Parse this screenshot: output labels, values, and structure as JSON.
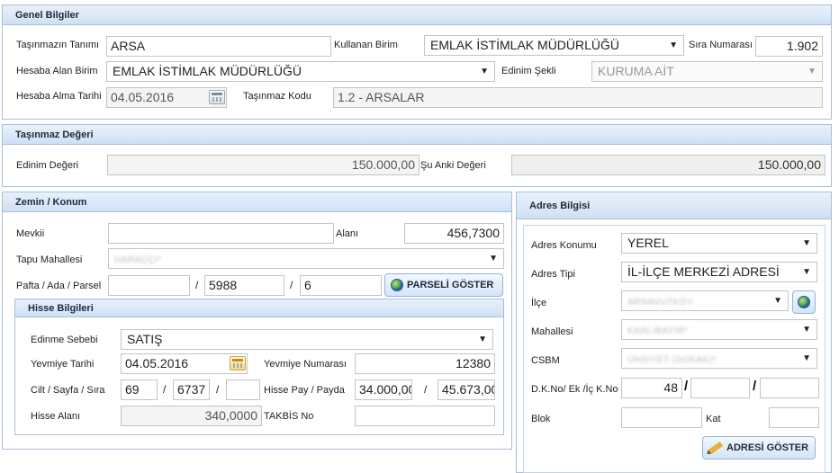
{
  "genel": {
    "title": "Genel Bilgiler",
    "tasinmaz_tanimi_label": "Taşınmazın Tanımı",
    "tasinmaz_tanimi_value": "ARSA",
    "kullanan_birim_label": "Kullanan Birim",
    "kullanan_birim_value": "EMLAK İSTİMLAK MÜDÜRLÜĞÜ",
    "sira_numarasi_label": "Sıra Numarası",
    "sira_numarasi_value": "1.902",
    "hesaba_alan_birim_label": "Hesaba Alan Birim",
    "hesaba_alan_birim_value": "EMLAK İSTİMLAK MÜDÜRLÜĞÜ",
    "edinim_sekli_label": "Edinim Şekli",
    "edinim_sekli_value": "KURUMA AİT",
    "hesaba_alma_tarihi_label": "Hesaba Alma Tarihi",
    "hesaba_alma_tarihi_value": "04.05.2016",
    "tasinmaz_kodu_label": "Taşınmaz Kodu",
    "tasinmaz_kodu_value": "1.2 - ARSALAR"
  },
  "deger": {
    "title": "Taşınmaz Değeri",
    "edinim_degeri_label": "Edinim Değeri",
    "edinim_degeri_value": "150.000,00",
    "su_anki_degeri_label": "Şu Anki Değeri",
    "su_anki_degeri_value": "150.000,00"
  },
  "zemin": {
    "title": "Zemin / Konum",
    "mevkii_label": "Mevkii",
    "mevkii_value": "",
    "alani_label": "Alanı",
    "alani_value": "456,7300",
    "tapu_mahallesi_label": "Tapu Mahallesi",
    "tapu_mahallesi_value": "HARAÇÇI*",
    "pafta_label": "Pafta / Ada / Parsel",
    "pafta_value": "",
    "ada_value": "5988",
    "parsel_value": "6",
    "slash": "/",
    "parseli_goster_label": "PARSELİ GÖSTER"
  },
  "hisse": {
    "title": "Hisse Bilgileri",
    "edinme_sebebi_label": "Edinme Sebebi",
    "edinme_sebebi_value": "SATIŞ",
    "yevmiye_tarihi_label": "Yevmiye Tarihi",
    "yevmiye_tarihi_value": "04.05.2016",
    "yevmiye_numarasi_label": "Yevmiye Numarası",
    "yevmiye_numarasi_value": "12380",
    "cilt_label": "Cilt / Sayfa / Sıra",
    "cilt_value": "69",
    "sayfa_value": "6737",
    "sira_value": "",
    "hisse_pay_label": "Hisse Pay / Payda",
    "hisse_pay_value": "34.000,00",
    "hisse_payda_value": "45.673,00",
    "hisse_alani_label": "Hisse Alanı",
    "hisse_alani_value": "340,0000",
    "takbis_label": "TAKBİS No",
    "takbis_value": ""
  },
  "adres": {
    "title": "Adres Bilgisi",
    "adres_konumu_label": "Adres Konumu",
    "adres_konumu_value": "YEREL",
    "adres_tipi_label": "Adres Tipi",
    "adres_tipi_value": "İL-İLÇE MERKEZİ ADRESİ",
    "ilce_label": "İlçe",
    "ilce_value": "ARNAVUTKÖY",
    "mahallesi_label": "Mahallesi",
    "mahallesi_value": "KARLIBAYIR*",
    "csbm_label": "CSBM",
    "csbm_value": "ÜNSİYET (SOKAK)*",
    "dkno_label": "D.K.No/ Ek /İç K.No",
    "dkno_value": "48",
    "ek_value": "",
    "ic_value": "",
    "blok_label": "Blok",
    "blok_value": "",
    "kat_label": "Kat",
    "kat_value": "",
    "adresi_goster_label": "ADRESİ GÖSTER"
  },
  "icons": {
    "dropdown": "▼",
    "calendar": "calendar-icon",
    "globe": "globe-icon",
    "pencil": "pencil-icon"
  }
}
